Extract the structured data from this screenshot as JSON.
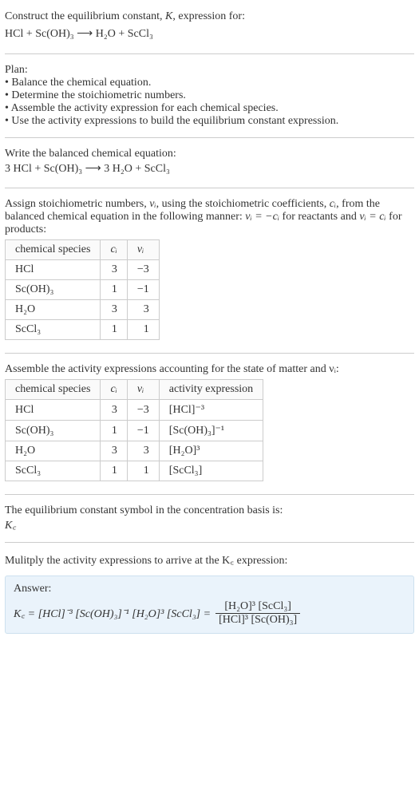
{
  "intro": {
    "line1": "Construct the equilibrium constant, ",
    "kital": "K",
    "line1b": ", expression for:",
    "equation_unbalanced": "HCl + Sc(OH)₃  ⟶  H₂O + ScCl₃"
  },
  "plan": {
    "heading": "Plan:",
    "items": [
      "• Balance the chemical equation.",
      "• Determine the stoichiometric numbers.",
      "• Assemble the activity expression for each chemical species.",
      "• Use the activity expressions to build the equilibrium constant expression."
    ]
  },
  "balanced": {
    "heading": "Write the balanced chemical equation:",
    "equation_balanced": "3 HCl + Sc(OH)₃  ⟶  3 H₂O + ScCl₃"
  },
  "stoich_intro": {
    "text_a": "Assign stoichiometric numbers, ",
    "nu": "νᵢ",
    "text_b": ", using the stoichiometric coefficients, ",
    "ci": "cᵢ",
    "text_c": ", from the balanced chemical equation in the following manner: ",
    "rel1": "νᵢ = −cᵢ",
    "text_d": " for reactants and ",
    "rel2": "νᵢ = cᵢ",
    "text_e": " for products:"
  },
  "table1": {
    "headers": {
      "species": "chemical species",
      "ci": "cᵢ",
      "nu": "νᵢ"
    },
    "rows": [
      {
        "species": "HCl",
        "ci": "3",
        "nu": "−3"
      },
      {
        "species": "Sc(OH)₃",
        "ci": "1",
        "nu": "−1"
      },
      {
        "species": "H₂O",
        "ci": "3",
        "nu": "3"
      },
      {
        "species": "ScCl₃",
        "ci": "1",
        "nu": "1"
      }
    ]
  },
  "activity_intro": "Assemble the activity expressions accounting for the state of matter and νᵢ:",
  "table2": {
    "headers": {
      "species": "chemical species",
      "ci": "cᵢ",
      "nu": "νᵢ",
      "act": "activity expression"
    },
    "rows": [
      {
        "species": "HCl",
        "ci": "3",
        "nu": "−3",
        "act": "[HCl]⁻³"
      },
      {
        "species": "Sc(OH)₃",
        "ci": "1",
        "nu": "−1",
        "act": "[Sc(OH)₃]⁻¹"
      },
      {
        "species": "H₂O",
        "ci": "3",
        "nu": "3",
        "act": "[H₂O]³"
      },
      {
        "species": "ScCl₃",
        "ci": "1",
        "nu": "1",
        "act": "[ScCl₃]"
      }
    ]
  },
  "kc_symbol": {
    "line": "The equilibrium constant symbol in the concentration basis is:",
    "sym": "K꜀"
  },
  "mult": "Mulitply the activity expressions to arrive at the K꜀ expression:",
  "answer": {
    "label": "Answer:",
    "lhs": "K꜀ = [HCl]⁻³ [Sc(OH)₃]⁻¹ [H₂O]³ [ScCl₃] = ",
    "frac_num": "[H₂O]³ [ScCl₃]",
    "frac_den": "[HCl]³ [Sc(OH)₃]"
  },
  "chart_data": {
    "type": "table",
    "tables": [
      {
        "title": "Stoichiometric numbers",
        "columns": [
          "chemical species",
          "c_i",
          "ν_i"
        ],
        "rows": [
          [
            "HCl",
            3,
            -3
          ],
          [
            "Sc(OH)3",
            1,
            -1
          ],
          [
            "H2O",
            3,
            3
          ],
          [
            "ScCl3",
            1,
            1
          ]
        ]
      },
      {
        "title": "Activity expressions",
        "columns": [
          "chemical species",
          "c_i",
          "ν_i",
          "activity expression"
        ],
        "rows": [
          [
            "HCl",
            3,
            -3,
            "[HCl]^-3"
          ],
          [
            "Sc(OH)3",
            1,
            -1,
            "[Sc(OH)3]^-1"
          ],
          [
            "H2O",
            3,
            3,
            "[H2O]^3"
          ],
          [
            "ScCl3",
            1,
            1,
            "[ScCl3]"
          ]
        ]
      }
    ]
  }
}
